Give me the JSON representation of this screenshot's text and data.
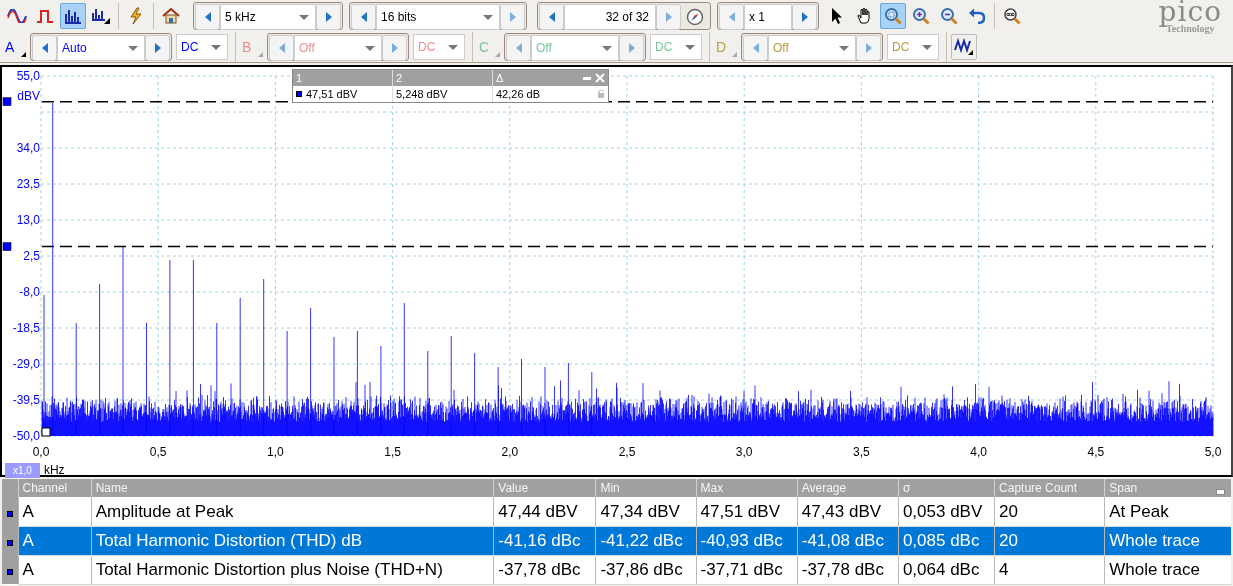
{
  "toolbar": {
    "view_modes": [
      {
        "kind": "scope",
        "selected": false
      },
      {
        "kind": "persistence",
        "selected": false
      },
      {
        "kind": "spectrum",
        "selected": true
      },
      {
        "kind": "spectrum_persistence",
        "selected": false
      }
    ],
    "actions": [
      {
        "kind": "auto_setup"
      },
      {
        "kind": "home"
      }
    ],
    "collection_range": {
      "value": "5 kHz"
    },
    "resolution": {
      "value": "16 bits"
    },
    "buffer": {
      "value": "32 of 32"
    },
    "zoom_factor": {
      "value": "x 1"
    },
    "tools": [
      {
        "kind": "pointer",
        "selected": false
      },
      {
        "kind": "hand",
        "selected": false
      },
      {
        "kind": "zoom_region",
        "selected": true
      },
      {
        "kind": "zoom_in",
        "selected": false
      },
      {
        "kind": "zoom_out",
        "selected": false
      },
      {
        "kind": "undo_zoom",
        "selected": false
      },
      {
        "kind": "zoom_100",
        "selected": false
      }
    ],
    "logo": {
      "name": "pico",
      "tagline": "Technology"
    }
  },
  "channels": [
    {
      "label": "A",
      "range": "Auto",
      "coupling": "DC",
      "enabled": true,
      "color": "#0000ff"
    },
    {
      "label": "B",
      "range": "Off",
      "coupling": "DC",
      "enabled": false,
      "color": "#f08c8c"
    },
    {
      "label": "C",
      "range": "Off",
      "coupling": "DC",
      "enabled": false,
      "color": "#78c49a"
    },
    {
      "label": "D",
      "range": "Off",
      "coupling": "DC",
      "enabled": false,
      "color": "#b89a40"
    }
  ],
  "chart": {
    "y_unit": "dBV",
    "y_ticks": [
      "55,0",
      "34,0",
      "23,5",
      "13,0",
      "2,5",
      "-8,0",
      "-18,5",
      "-29,0",
      "-39,5",
      "-50,0"
    ],
    "x_ticks": [
      "0,0",
      "0,5",
      "1,0",
      "1,5",
      "2,0",
      "2,5",
      "3,0",
      "3,5",
      "4,0",
      "4,5",
      "5,0"
    ],
    "x_zoom": "x1,0",
    "x_unit": "kHz"
  },
  "ruler_readout": {
    "columns": [
      "1",
      "2",
      "Δ"
    ],
    "values": [
      "47,51 dBV",
      "5,248 dBV",
      "42,26 dB"
    ]
  },
  "measurements": {
    "columns": [
      "Channel",
      "Name",
      "Value",
      "Min",
      "Max",
      "Average",
      "σ",
      "Capture Count",
      "Span"
    ],
    "rows": [
      {
        "cells": [
          "A",
          "Amplitude at Peak",
          "47,44 dBV",
          "47,34 dBV",
          "47,51 dBV",
          "47,43 dBV",
          "0,053 dBV",
          "20",
          "At Peak"
        ],
        "selected": false
      },
      {
        "cells": [
          "A",
          "Total Harmonic Distortion (THD) dB",
          "-41,16 dBc",
          "-41,22 dBc",
          "-40,93 dBc",
          "-41,08 dBc",
          "0,085 dBc",
          "20",
          "Whole trace"
        ],
        "selected": true
      },
      {
        "cells": [
          "A",
          "Total Harmonic Distortion plus Noise (THD+N)",
          "-37,78 dBc",
          "-37,86 dBc",
          "-37,71 dBc",
          "-37,78 dBc",
          "0,064 dBc",
          "4",
          "Whole trace"
        ],
        "selected": false
      }
    ]
  }
}
